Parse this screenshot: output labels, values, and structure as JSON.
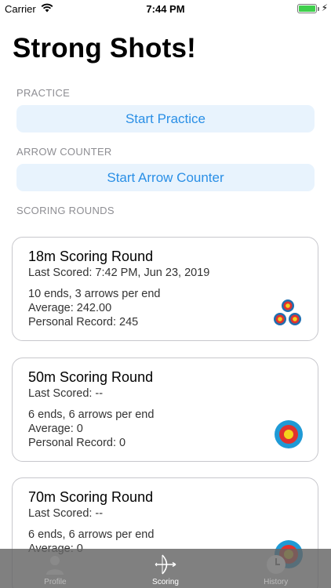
{
  "status_bar": {
    "carrier": "Carrier",
    "time": "7:44 PM",
    "battery_level": 1.0
  },
  "page": {
    "title": "Strong Shots!"
  },
  "practice": {
    "header": "PRACTICE",
    "button_label": "Start Practice"
  },
  "arrow_counter": {
    "header": "ARROW COUNTER",
    "button_label": "Start Arrow Counter"
  },
  "scoring_rounds": {
    "header": "SCORING ROUNDS",
    "rounds": [
      {
        "title": "18m Scoring Round",
        "last_scored": "Last Scored: 7:42 PM, Jun 23, 2019",
        "info": "10 ends, 3 arrows per end",
        "average": "Average: 242.00",
        "record": "Personal Record: 245",
        "icon": "triple-target-icon"
      },
      {
        "title": "50m Scoring Round",
        "last_scored": "Last Scored: --",
        "info": "6 ends, 6 arrows per end",
        "average": "Average: 0",
        "record": "Personal Record: 0",
        "icon": "target-icon"
      },
      {
        "title": "70m Scoring Round",
        "last_scored": "Last Scored: --",
        "info": "6 ends, 6 arrows per end",
        "average": "Average: 0",
        "record": "",
        "icon": "target-icon"
      }
    ]
  },
  "tab_bar": {
    "tabs": [
      {
        "label": "Profile",
        "icon": "person-icon",
        "active": false
      },
      {
        "label": "Scoring",
        "icon": "bow-arrow-icon",
        "active": true
      },
      {
        "label": "History",
        "icon": "clock-icon",
        "active": false
      }
    ]
  },
  "colors": {
    "accent": "#2a8fe6",
    "button_bg": "#e8f3fd",
    "header_gray": "#8e8e93",
    "target_outer": "#1f6fb0",
    "target_middle": "#e0322f",
    "target_center": "#f3d31c"
  }
}
